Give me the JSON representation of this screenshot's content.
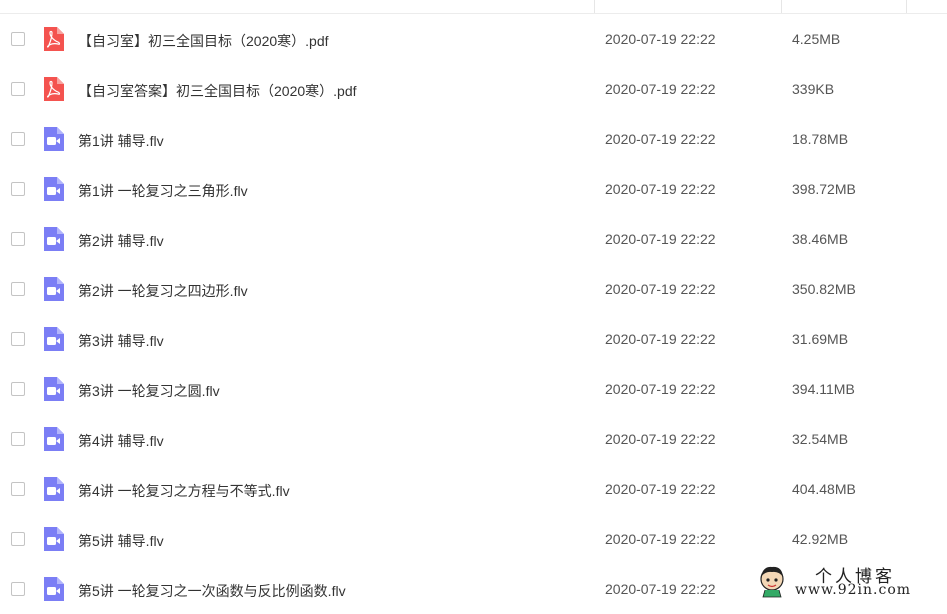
{
  "files": [
    {
      "name": "【自习室】初三全国目标（2020寒）.pdf",
      "date": "2020-07-19 22:22",
      "size": "4.25MB",
      "type": "pdf"
    },
    {
      "name": "【自习室答案】初三全国目标（2020寒）.pdf",
      "date": "2020-07-19 22:22",
      "size": "339KB",
      "type": "pdf"
    },
    {
      "name": "第1讲 辅导.flv",
      "date": "2020-07-19 22:22",
      "size": "18.78MB",
      "type": "video"
    },
    {
      "name": "第1讲 一轮复习之三角形.flv",
      "date": "2020-07-19 22:22",
      "size": "398.72MB",
      "type": "video"
    },
    {
      "name": "第2讲 辅导.flv",
      "date": "2020-07-19 22:22",
      "size": "38.46MB",
      "type": "video"
    },
    {
      "name": "第2讲 一轮复习之四边形.flv",
      "date": "2020-07-19 22:22",
      "size": "350.82MB",
      "type": "video"
    },
    {
      "name": "第3讲 辅导.flv",
      "date": "2020-07-19 22:22",
      "size": "31.69MB",
      "type": "video"
    },
    {
      "name": "第3讲 一轮复习之圆.flv",
      "date": "2020-07-19 22:22",
      "size": "394.11MB",
      "type": "video"
    },
    {
      "name": "第4讲 辅导.flv",
      "date": "2020-07-19 22:22",
      "size": "32.54MB",
      "type": "video"
    },
    {
      "name": "第4讲 一轮复习之方程与不等式.flv",
      "date": "2020-07-19 22:22",
      "size": "404.48MB",
      "type": "video"
    },
    {
      "name": "第5讲 辅导.flv",
      "date": "2020-07-19 22:22",
      "size": "42.92MB",
      "type": "video"
    },
    {
      "name": "第5讲 一轮复习之一次函数与反比例函数.flv",
      "date": "2020-07-19 22:22",
      "size": "",
      "type": "video"
    }
  ],
  "icons": {
    "pdf": "pdf-file-icon",
    "video": "video-file-icon"
  },
  "colors": {
    "pdf": "#f4534f",
    "video": "#7b7ef5",
    "text": "#333333"
  },
  "watermark": {
    "title": "个人博客",
    "url": "www.92in.com"
  }
}
